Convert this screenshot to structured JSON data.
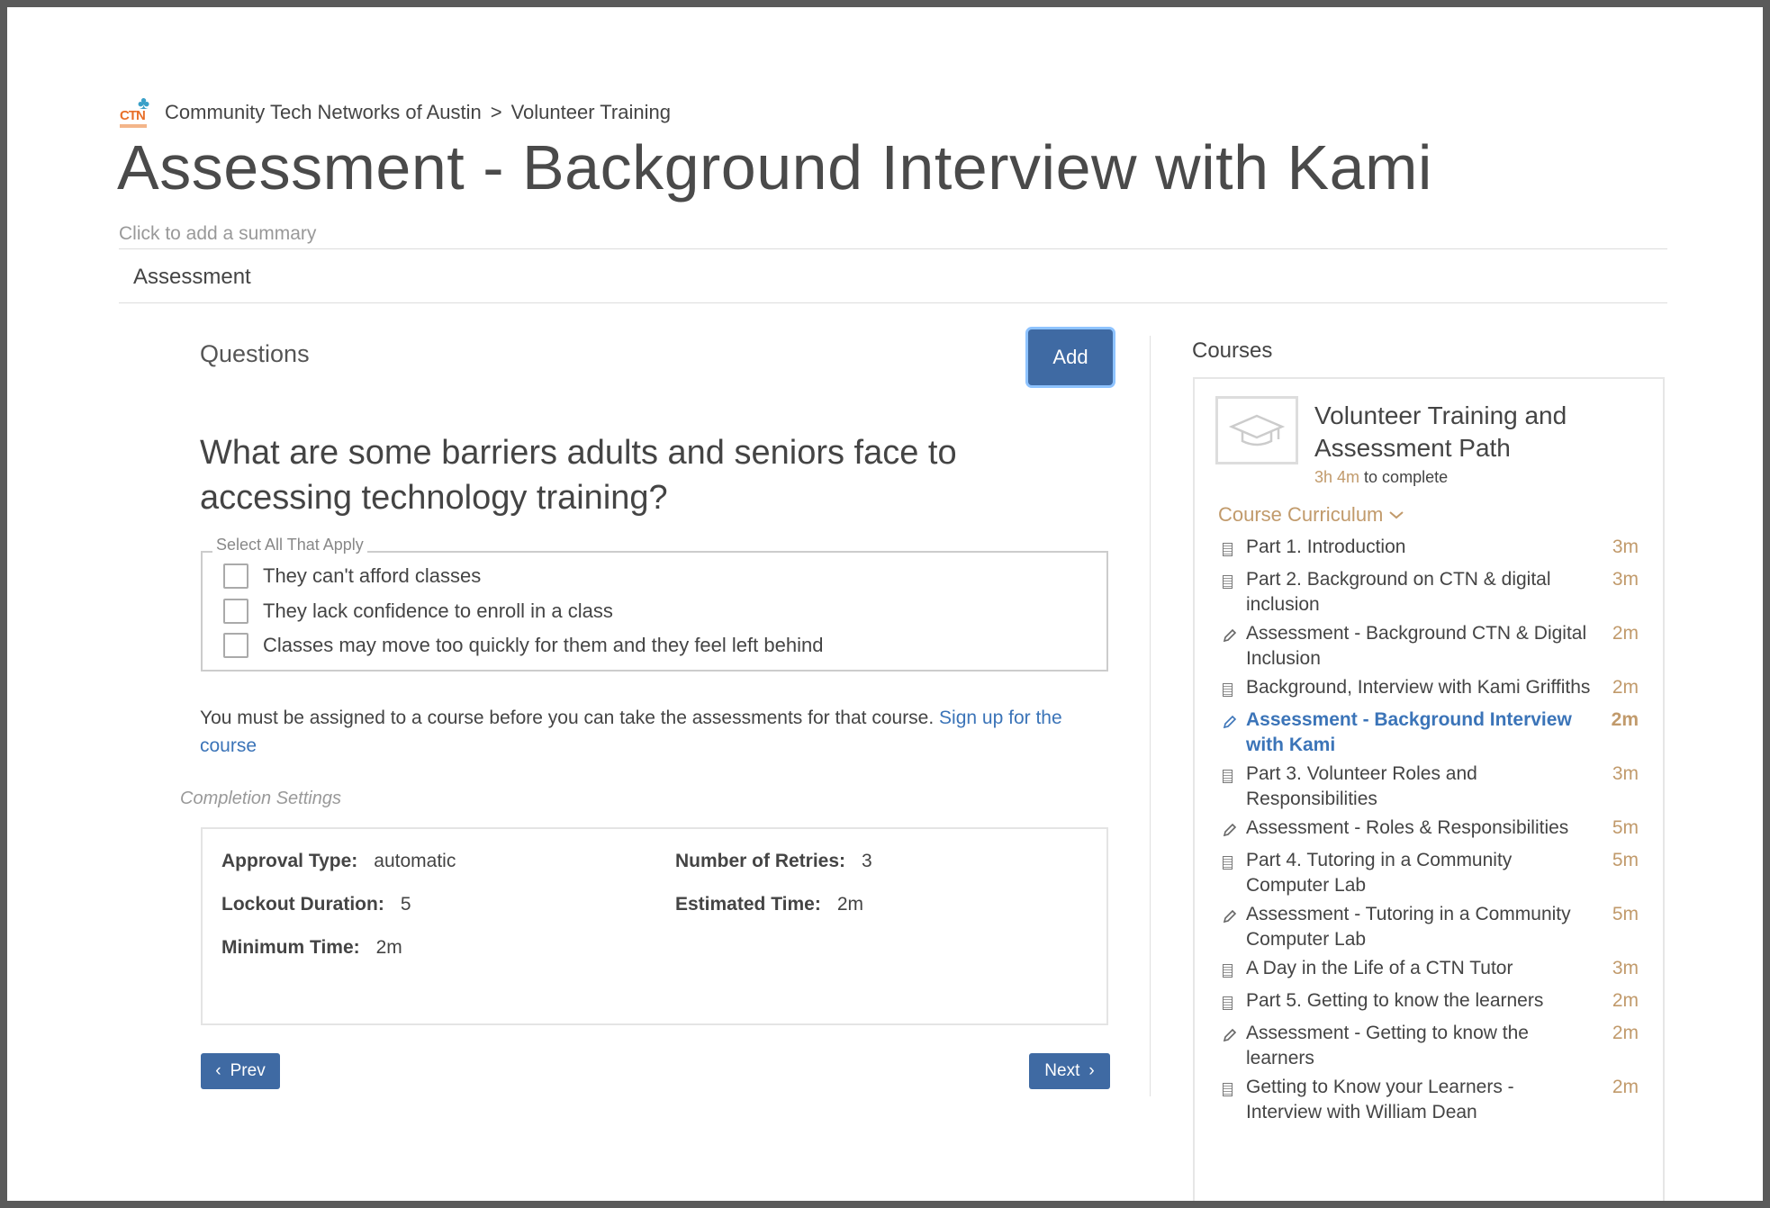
{
  "breadcrumb": {
    "org": "Community Tech Networks of Austin",
    "separator": ">",
    "section": "Volunteer Training",
    "logo_text": "CTN"
  },
  "page": {
    "title": "Assessment - Background Interview with Kami",
    "summary_placeholder": "Click to add a summary",
    "section_tab": "Assessment"
  },
  "questions": {
    "label": "Questions",
    "add_label": "Add",
    "question_text": "What are some barriers adults and seniors face to accessing technology training?",
    "legend": "Select All That Apply",
    "options": [
      "They can't afford classes",
      "They lack confidence to enroll in a class",
      "Classes may move too quickly for them and they feel left behind"
    ],
    "notice": "You must be assigned to a course before you can take the assessments for that course.",
    "notice_link": "Sign up for the course"
  },
  "completion": {
    "label": "Completion Settings",
    "approval_type_label": "Approval Type:",
    "approval_type": "automatic",
    "retries_label": "Number of Retries:",
    "retries": "3",
    "lockout_label": "Lockout Duration:",
    "lockout": "5",
    "estimated_label": "Estimated Time:",
    "estimated": "2m",
    "minimum_label": "Minimum Time:",
    "minimum": "2m"
  },
  "nav": {
    "prev": "Prev",
    "next": "Next"
  },
  "courses": {
    "label": "Courses",
    "title": "Volunteer Training and Assessment Path",
    "time_value": "3h 4m",
    "time_suffix": "to complete",
    "curriculum_label": "Course Curriculum",
    "items": [
      {
        "icon": "document-icon",
        "title": "Part 1. Introduction",
        "duration": "3m"
      },
      {
        "icon": "document-icon",
        "title": "Part 2. Background on CTN & digital inclusion",
        "duration": "3m"
      },
      {
        "icon": "pencil-icon",
        "title": "Assessment - Background CTN & Digital Inclusion",
        "duration": "2m"
      },
      {
        "icon": "document-icon",
        "title": "Background, Interview with Kami Griffiths",
        "duration": "2m"
      },
      {
        "icon": "pencil-icon",
        "title": "Assessment - Background Interview with Kami",
        "duration": "2m",
        "active": true
      },
      {
        "icon": "document-icon",
        "title": "Part 3. Volunteer Roles and Responsibilities",
        "duration": "3m"
      },
      {
        "icon": "pencil-icon",
        "title": "Assessment - Roles & Responsibilities",
        "duration": "5m"
      },
      {
        "icon": "document-icon",
        "title": "Part 4. Tutoring in a Community Computer Lab",
        "duration": "5m"
      },
      {
        "icon": "pencil-icon",
        "title": "Assessment - Tutoring in a Community Computer Lab",
        "duration": "5m"
      },
      {
        "icon": "document-icon",
        "title": "A Day in the Life of a CTN Tutor",
        "duration": "3m"
      },
      {
        "icon": "document-icon",
        "title": "Part 5. Getting to know the learners",
        "duration": "2m"
      },
      {
        "icon": "pencil-icon",
        "title": "Assessment - Getting to know the learners",
        "duration": "2m"
      },
      {
        "icon": "document-icon",
        "title": "Getting to Know your Learners - Interview with William Dean",
        "duration": "2m"
      }
    ]
  },
  "colors": {
    "primary": "#3f6aa3",
    "link": "#3b74b8",
    "accent": "#c19a6b"
  }
}
